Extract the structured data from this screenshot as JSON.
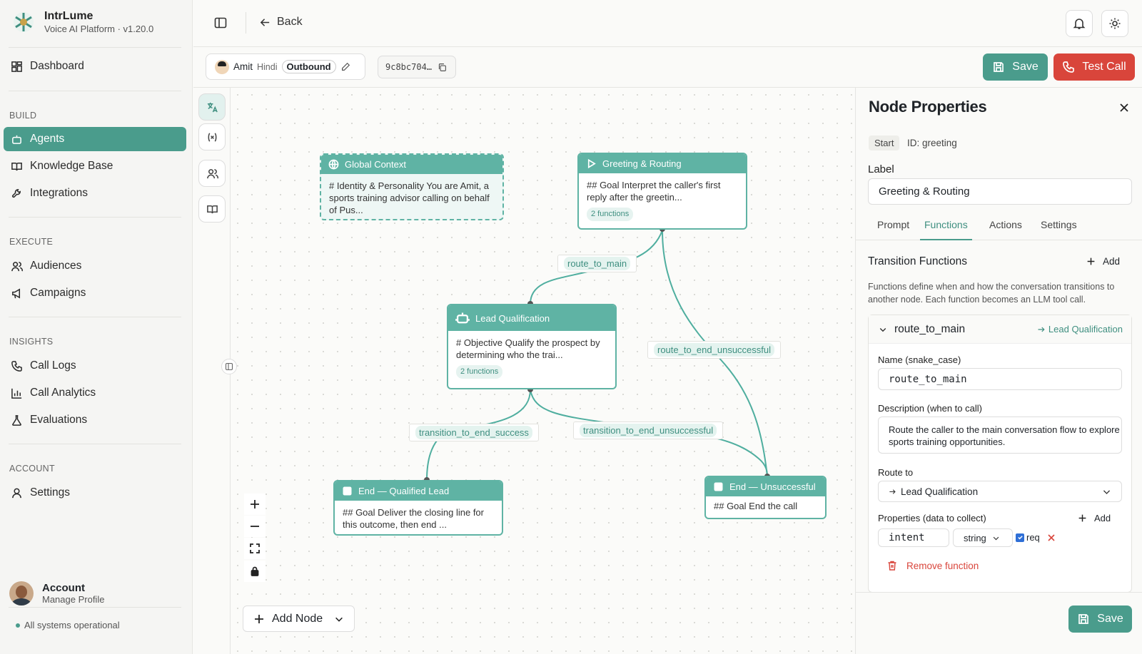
{
  "brand": {
    "title": "IntrLume",
    "subtitle": "Voice AI Platform · v1.20.0"
  },
  "nav": {
    "dashboard": "Dashboard",
    "build_label": "BUILD",
    "agents": "Agents",
    "knowledge_base": "Knowledge Base",
    "integrations": "Integrations",
    "execute_label": "EXECUTE",
    "audiences": "Audiences",
    "campaigns": "Campaigns",
    "insights_label": "INSIGHTS",
    "call_logs": "Call Logs",
    "call_analytics": "Call Analytics",
    "evaluations": "Evaluations",
    "account_label": "ACCOUNT",
    "settings": "Settings"
  },
  "account": {
    "title": "Account",
    "subtitle": "Manage Profile"
  },
  "status": "All systems operational",
  "topbar": {
    "back": "Back"
  },
  "agent": {
    "name": "Amit",
    "language": "Hindi",
    "direction": "Outbound",
    "id": "9c8bc704…"
  },
  "actions": {
    "save": "Save",
    "test_call": "Test Call"
  },
  "nodes": {
    "global": {
      "title": "Global Context",
      "body": "# Identity & Personality You are Amit, a sports training advisor calling on behalf of Pus..."
    },
    "greeting": {
      "title": "Greeting & Routing",
      "body": "## Goal Interpret the caller's first reply after the greetin...",
      "functions": "2 functions"
    },
    "lead": {
      "title": "Lead Qualification",
      "body": "# Objective Qualify the prospect by determining who the trai...",
      "functions": "2 functions"
    },
    "qualified": {
      "title": "End — Qualified Lead",
      "body": "## Goal Deliver the closing line for this outcome, then end ..."
    },
    "unsuccessful": {
      "title": "End — Unsuccessful",
      "body": "## Goal End the call"
    }
  },
  "edges": {
    "route_to_main": "route_to_main",
    "route_to_end_unsuccessful": "route_to_end_unsuccessful",
    "transition_to_end_success": "transition_to_end_success",
    "transition_to_end_unsuccessful": "transition_to_end_unsuccessful"
  },
  "canvas": {
    "add_node": "Add Node"
  },
  "panel": {
    "title": "Node Properties",
    "start_tag": "Start",
    "id_text": "ID: greeting",
    "label_heading": "Label",
    "label_value": "Greeting & Routing",
    "tabs": [
      "Prompt",
      "Functions",
      "Actions",
      "Settings"
    ],
    "transition_heading": "Transition Functions",
    "add": "Add",
    "transition_desc": "Functions define when and how the conversation transitions to another node. Each function becomes an LLM tool call.",
    "function": {
      "name": "route_to_main",
      "target": "Lead Qualification",
      "name_label": "Name (snake_case)",
      "name_value": "route_to_main",
      "desc_label": "Description (when to call)",
      "desc_value": "Route the caller to the main conversation flow to explore sports training opportunities.",
      "route_label": "Route to",
      "route_value": "Lead Qualification",
      "props_label": "Properties (data to collect)",
      "prop_name": "intent",
      "prop_type": "string",
      "prop_req": "req",
      "remove": "Remove function"
    },
    "save": "Save"
  },
  "colors": {
    "accent": "#4a9c8c",
    "node": "#5fb3a4",
    "danger": "#d9453b"
  }
}
